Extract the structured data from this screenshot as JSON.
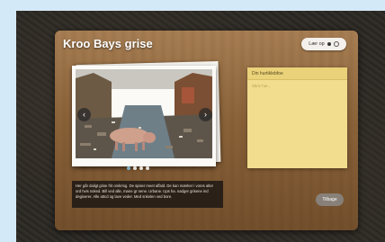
{
  "app": {
    "title": "Kroo Bays grise"
  },
  "toolbar": {
    "listen_label": "Lær op"
  },
  "carousel": {
    "prev_symbol": "‹",
    "next_symbol": "›",
    "dot_count": 4,
    "active_index": 0,
    "caption": "Her går daligt grise frit omkring. De spiser meet affald. De kan mærker i vores alter ord hvis noked. Bill ved alle, mane gr nene. Urbane. Ups ha. nadger grisene ind degiverer. Alle attcd og lave veder. Med snkelen ved bore."
  },
  "note": {
    "heading": "Din hurtiklebfoe",
    "placeholder": "Skriv her..."
  },
  "footer": {
    "back_label": "Tilbage"
  },
  "colors": {
    "accent_dot": "#7fb1c7",
    "note_yellow": "#f1dd8d"
  }
}
